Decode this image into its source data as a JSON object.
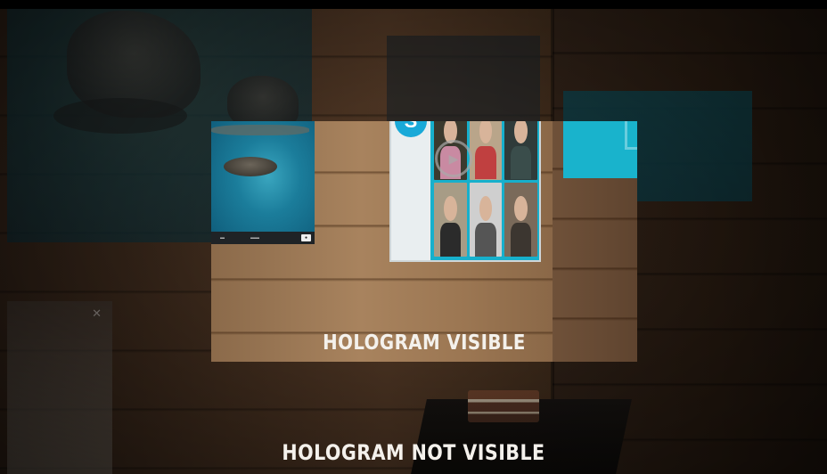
{
  "captions": {
    "visible": "HOLOGRAM VISIBLE",
    "not_visible": "HOLOGRAM NOT VISIBLE"
  },
  "icons": {
    "skype": "skype-icon",
    "play": "play-icon",
    "close": "close-icon"
  },
  "skype_logo_letter": "S",
  "colors": {
    "hologram_cyan": "#19b3cc",
    "caption_text": "#f4f1ec",
    "wood_visible": "#a8835e",
    "wood_dim": "#3d2a1c"
  }
}
